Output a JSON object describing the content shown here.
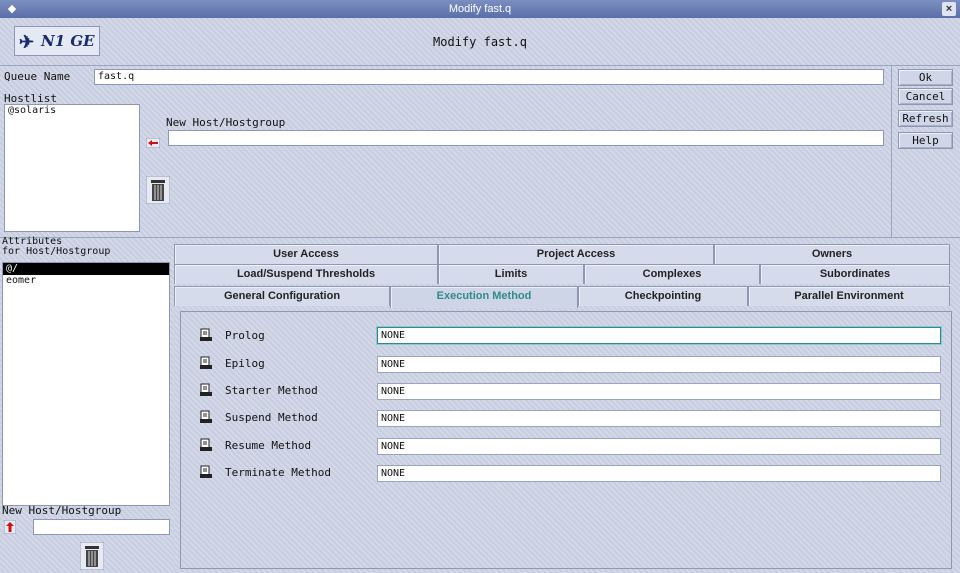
{
  "window": {
    "title": "Modify fast.q"
  },
  "header": {
    "logo_text": "N1 GE",
    "title": "Modify fast.q"
  },
  "queue": {
    "label": "Queue Name",
    "value": "fast.q"
  },
  "hostlist": {
    "label": "Hostlist",
    "items": [
      "@solaris"
    ],
    "new_label": "New Host/Hostgroup",
    "new_value": ""
  },
  "side_buttons": {
    "ok": "Ok",
    "cancel": "Cancel",
    "refresh": "Refresh",
    "help": "Help"
  },
  "attributes": {
    "label_line1": "Attributes",
    "label_line2": "for Host/Hostgroup",
    "items": [
      "@/",
      "eomer"
    ],
    "selected_index": 0,
    "new_label": "New Host/Hostgroup",
    "new_value": ""
  },
  "tabs": {
    "row1": [
      "User Access",
      "Project Access",
      "Owners"
    ],
    "row2": [
      "Load/Suspend Thresholds",
      "Limits",
      "Complexes",
      "Subordinates"
    ],
    "row3": [
      "General Configuration",
      "Execution Method",
      "Checkpointing",
      "Parallel Environment"
    ],
    "active": "Execution Method"
  },
  "execution_method": {
    "rows": [
      {
        "label": "Prolog",
        "value": "NONE"
      },
      {
        "label": "Epilog",
        "value": "NONE"
      },
      {
        "label": "Starter Method",
        "value": "NONE"
      },
      {
        "label": "Suspend Method",
        "value": "NONE"
      },
      {
        "label": "Resume Method",
        "value": "NONE"
      },
      {
        "label": "Terminate Method",
        "value": "NONE"
      }
    ]
  },
  "icons": {
    "logo": "flying-figure-icon",
    "add_arrow": "add-arrow-icon",
    "trash": "trash-icon",
    "field_button": "file-picker-icon"
  },
  "colors": {
    "titlebar": "#6b7fb5",
    "active_tab_text": "#2f8a8f",
    "panel": "#cdd4e6"
  }
}
